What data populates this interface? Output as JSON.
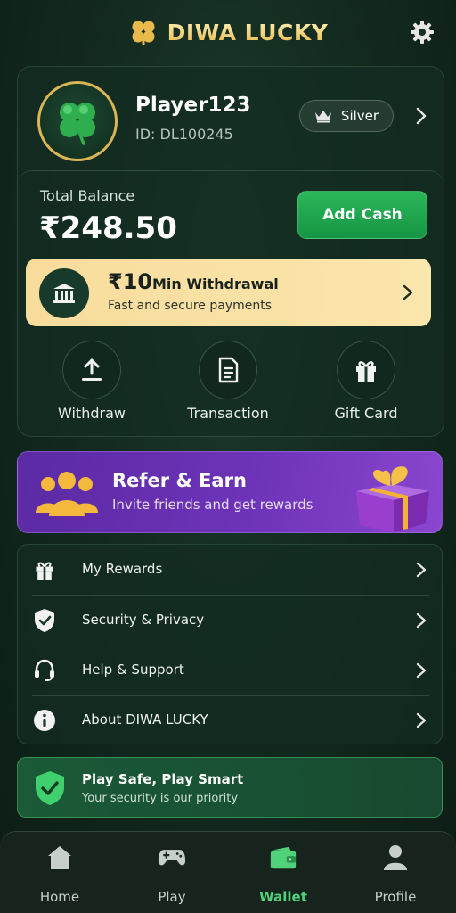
{
  "header": {
    "title": "DIWA LUCKY",
    "logo_icon": "clover-icon",
    "settings_icon": "gear-icon"
  },
  "profile": {
    "name": "Player123",
    "id": "ID: DL100245",
    "tier": "Silver",
    "tier_icon": "crown-icon"
  },
  "balance": {
    "label": "Total Balance",
    "amount": "₹248.50",
    "add_cash": "Add Cash"
  },
  "withdrawal_banner": {
    "amount": "₹10",
    "title": "Min Withdrawal",
    "subtitle": "Fast and secure payments",
    "icon": "bank-icon"
  },
  "quick_actions": [
    {
      "label": "Withdraw",
      "icon": "upload-icon"
    },
    {
      "label": "Transaction",
      "icon": "document-icon"
    },
    {
      "label": "Gift Card",
      "icon": "gift-icon"
    }
  ],
  "refer": {
    "title": "Refer & Earn",
    "subtitle": "Invite friends and get rewards"
  },
  "menu": [
    {
      "label": "My Rewards",
      "icon": "gift-icon"
    },
    {
      "label": "Security & Privacy",
      "icon": "shield-check-icon"
    },
    {
      "label": "Help & Support",
      "icon": "headset-icon"
    },
    {
      "label": "About DIWA LUCKY",
      "icon": "info-icon"
    }
  ],
  "safe_banner": {
    "title": "Play Safe, Play Smart",
    "subtitle": "Your security is our priority"
  },
  "nav": [
    {
      "label": "Home",
      "icon": "home-icon"
    },
    {
      "label": "Play",
      "icon": "gamepad-icon"
    },
    {
      "label": "Wallet",
      "icon": "wallet-icon",
      "active": true
    },
    {
      "label": "Profile",
      "icon": "user-icon"
    }
  ],
  "colors": {
    "accent_green": "#4fd27a",
    "gold": "#e8b94a",
    "purple": "#6d33b8",
    "banner_yellow": "#f8dc9c"
  }
}
